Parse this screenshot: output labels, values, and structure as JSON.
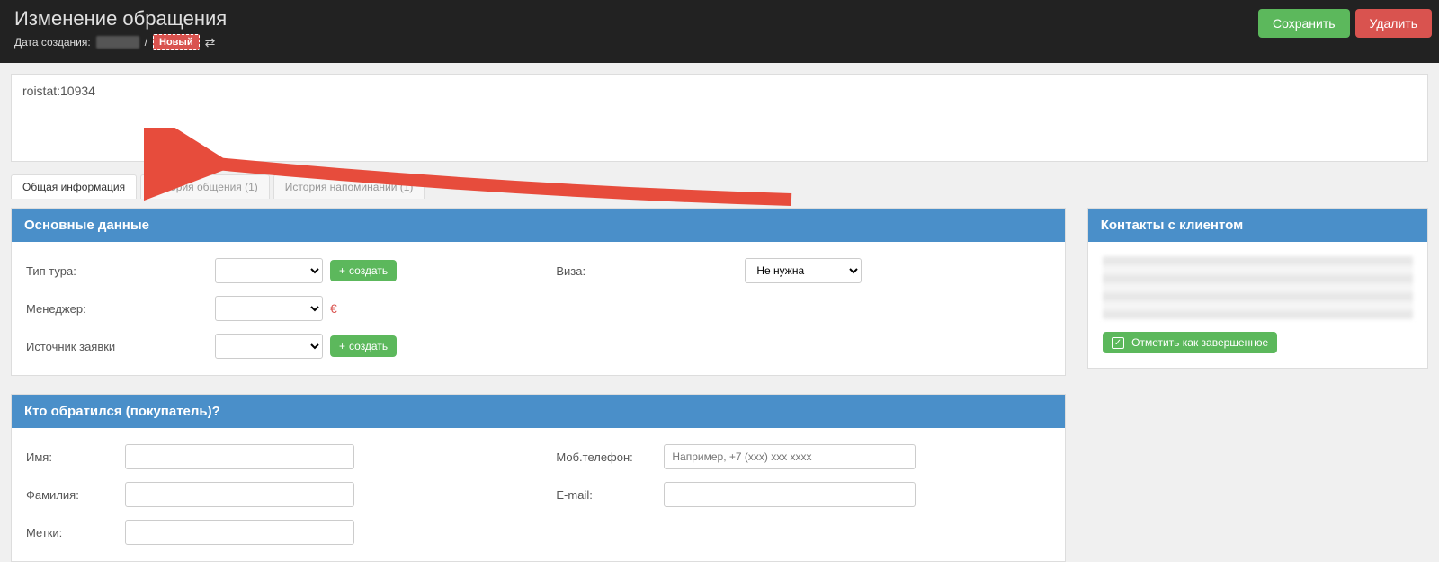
{
  "header": {
    "title": "Изменение обращения",
    "created_label": "Дата создания:",
    "separator": "/",
    "badge": "Новый",
    "save_label": "Сохранить",
    "delete_label": "Удалить"
  },
  "roistat": {
    "text": "roistat:10934"
  },
  "tabs": [
    {
      "label": "Общая информация"
    },
    {
      "label": "История общения (1)"
    },
    {
      "label": "История напоминаний (1)"
    }
  ],
  "panels": {
    "main_data_title": "Основные данные",
    "buyer_title": "Кто обратился (покупатель)?",
    "contacts_title": "Контакты с клиентом"
  },
  "fields": {
    "tour_type": "Тип тура:",
    "manager": "Менеджер:",
    "source": "Источник заявки",
    "visa": "Виза:",
    "visa_value": "Не нужна",
    "create_btn": "создать",
    "currency": "€",
    "name": "Имя:",
    "surname": "Фамилия:",
    "tags": "Метки:",
    "phone": "Моб.телефон:",
    "email": "E-mail:",
    "phone_placeholder": "Например, +7 (xxx) xxx xxxx"
  },
  "side": {
    "mark_done": "Отметить как завершенное"
  }
}
